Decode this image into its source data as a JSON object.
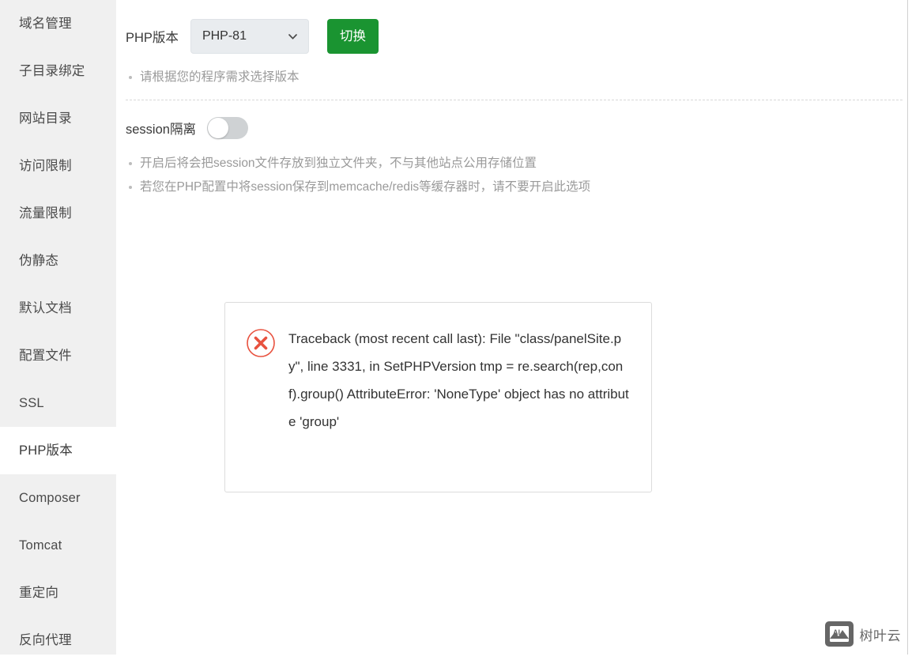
{
  "sidebar": {
    "items": [
      {
        "label": "域名管理",
        "active": false
      },
      {
        "label": "子目录绑定",
        "active": false
      },
      {
        "label": "网站目录",
        "active": false
      },
      {
        "label": "访问限制",
        "active": false
      },
      {
        "label": "流量限制",
        "active": false
      },
      {
        "label": "伪静态",
        "active": false
      },
      {
        "label": "默认文档",
        "active": false
      },
      {
        "label": "配置文件",
        "active": false
      },
      {
        "label": "SSL",
        "active": false
      },
      {
        "label": "PHP版本",
        "active": true
      },
      {
        "label": "Composer",
        "active": false
      },
      {
        "label": "Tomcat",
        "active": false
      },
      {
        "label": "重定向",
        "active": false
      },
      {
        "label": "反向代理",
        "active": false
      }
    ]
  },
  "php_version": {
    "label": "PHP版本",
    "selected": "PHP-81",
    "switch_button": "切换",
    "dropdown_icon": "chevron-down-icon",
    "hint": "请根据您的程序需求选择版本"
  },
  "session": {
    "label": "session隔离",
    "enabled": false,
    "hints": [
      "开启后将会把session文件存放到独立文件夹，不与其他站点公用存储位置",
      "若您在PHP配置中将session保存到memcache/redis等缓存器时，请不要开启此选项"
    ]
  },
  "error_dialog": {
    "icon": "error-circle-x-icon",
    "message": "Traceback (most recent call last): File \"class/panelSite.py\", line 3331, in SetPHPVersion tmp = re.search(rep,conf).group() AttributeError: 'NoneType' object has no attribute 'group'"
  },
  "watermark": {
    "badge_text": "AI",
    "text": "树叶云"
  },
  "colors": {
    "sidebar_bg": "#f0f0f0",
    "accent_green": "#1a9431",
    "error_red": "#e8523f",
    "muted_text": "#9a9a9a"
  }
}
